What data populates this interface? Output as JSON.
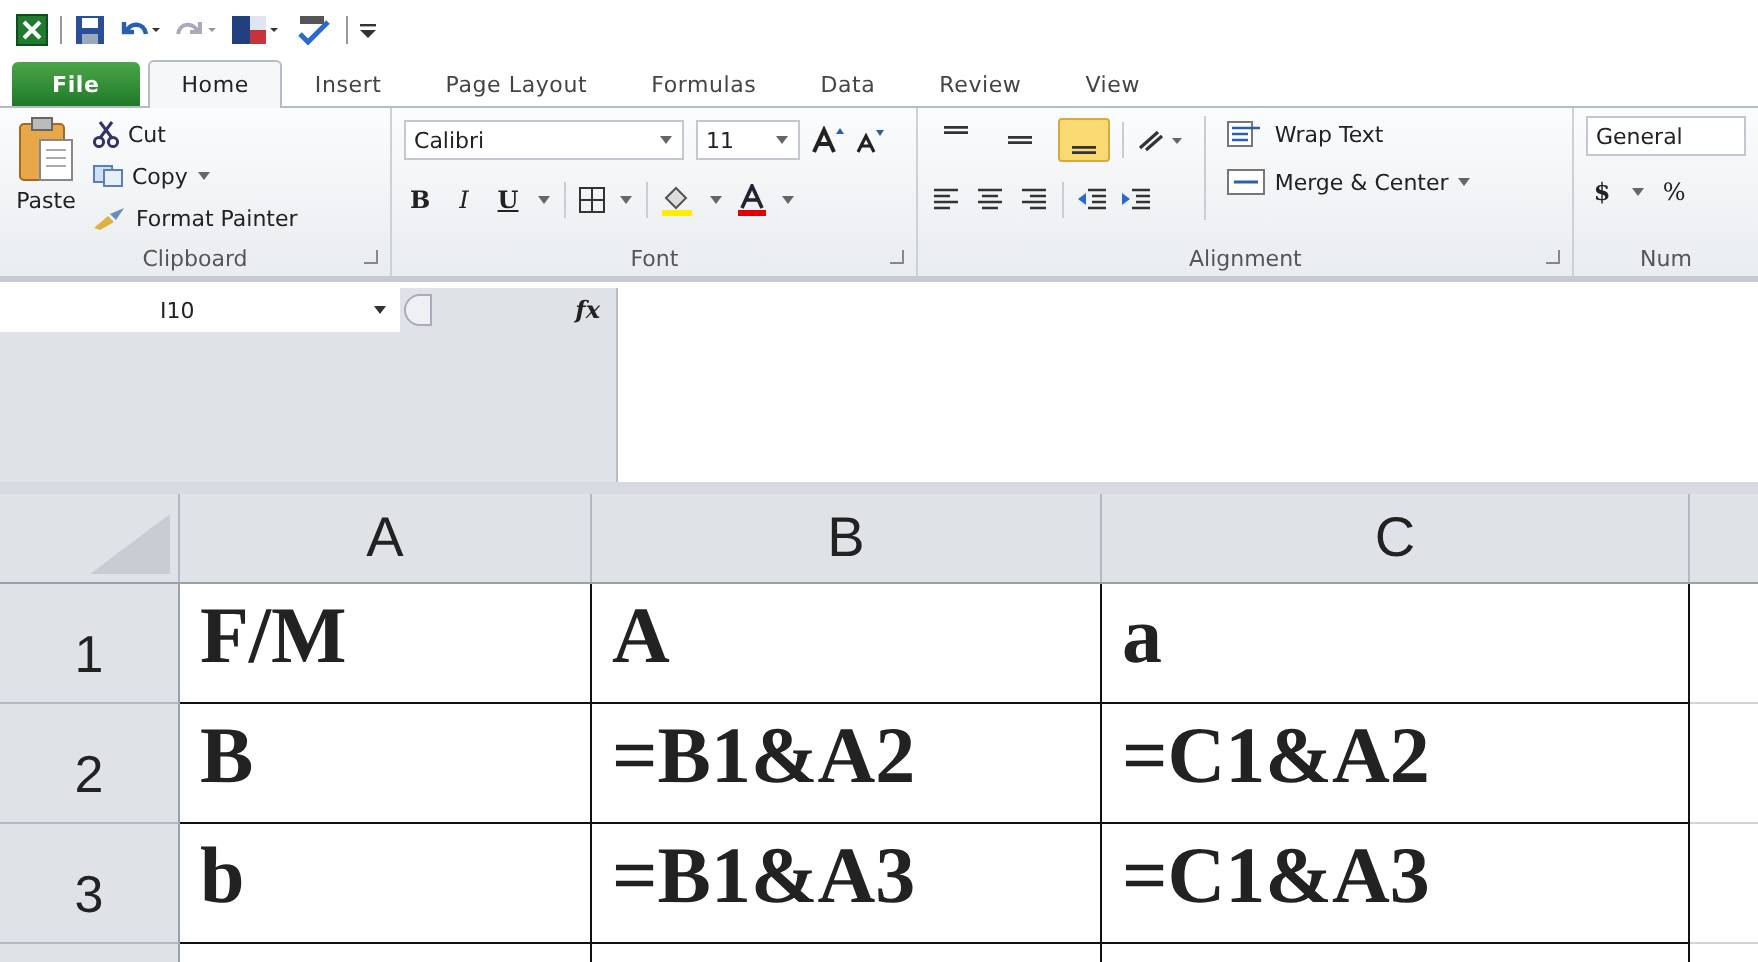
{
  "tabs": [
    {
      "label": "File",
      "kind": "file",
      "selected": false
    },
    {
      "label": "Home",
      "kind": "tab",
      "selected": true
    },
    {
      "label": "Insert",
      "kind": "tab",
      "selected": false
    },
    {
      "label": "Page Layout",
      "kind": "tab",
      "selected": false
    },
    {
      "label": "Formulas",
      "kind": "tab",
      "selected": false
    },
    {
      "label": "Data",
      "kind": "tab",
      "selected": false
    },
    {
      "label": "Review",
      "kind": "tab",
      "selected": false
    },
    {
      "label": "View",
      "kind": "tab",
      "selected": false
    }
  ],
  "clipboard": {
    "paste": "Paste",
    "cut": "Cut",
    "copy": "Copy",
    "format_painter": "Format Painter",
    "label": "Clipboard"
  },
  "font": {
    "name": "Calibri",
    "size": "11",
    "bold": "B",
    "italic": "I",
    "underline": "U",
    "label": "Font"
  },
  "alignment": {
    "vertical": [
      {
        "selected": false
      },
      {
        "selected": false
      },
      {
        "selected": true
      }
    ],
    "wrap_text": "Wrap Text",
    "merge": "Merge & Center",
    "label": "Alignment"
  },
  "number": {
    "format": "General",
    "currency": "$",
    "percent": "%",
    "label": "Num"
  },
  "formula_bar": {
    "name_box": "I10",
    "fx": "fx"
  },
  "sheet": {
    "columns": [
      "A",
      "B",
      "C"
    ],
    "rows": [
      {
        "header": "1",
        "cells": [
          "F/M",
          "A",
          "a"
        ]
      },
      {
        "header": "2",
        "cells": [
          "B",
          "=B1&A2",
          "=C1&A2"
        ]
      },
      {
        "header": "3",
        "cells": [
          "b",
          "=B1&A3",
          "=C1&A3"
        ]
      }
    ]
  }
}
